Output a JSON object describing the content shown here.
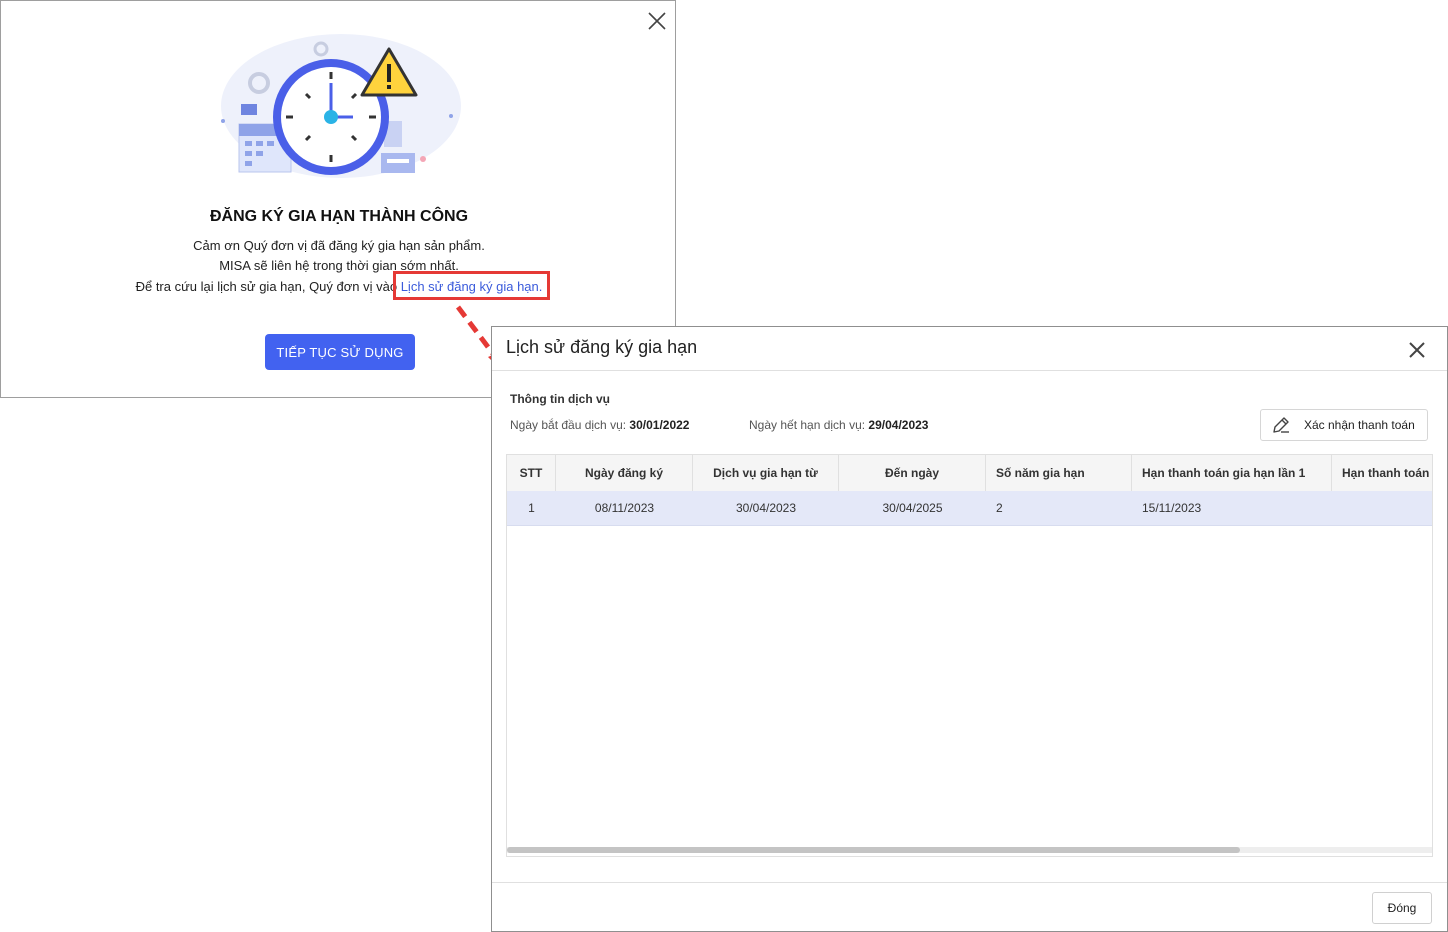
{
  "success_dialog": {
    "title": "ĐĂNG KÝ GIA HẠN THÀNH CÔNG",
    "line1": "Cảm ơn Quý đơn vị đã đăng ký gia hạn sản phẩm.",
    "line2": "MISA sẽ liên hệ trong thời gian sớm nhất.",
    "line3_prefix": "Để tra cứu lại lịch sử gia hạn, Quý đơn vị vào ",
    "history_link": "Lịch sử đăng ký gia hạn.",
    "continue_button": "TIẾP TỤC SỬ DỤNG",
    "close_icon": "close-icon",
    "highlight_color": "#e53935",
    "accent_color": "#4262f0"
  },
  "history_dialog": {
    "title": "Lịch sử đăng ký gia hạn",
    "close_icon": "close-icon",
    "section_title": "Thông tin dịch vụ",
    "start_label": "Ngày bắt đầu dịch vụ: ",
    "start_value": "30/01/2022",
    "end_label": "Ngày hết hạn dịch vụ: ",
    "end_value": "29/04/2023",
    "confirm_button": "Xác nhận thanh toán",
    "confirm_icon": "pencil-icon",
    "columns": [
      "STT",
      "Ngày đăng ký",
      "Dịch vụ gia hạn từ",
      "Đến ngày",
      "Số năm gia hạn",
      "Hạn thanh toán gia hạn lần 1",
      "Hạn thanh toán"
    ],
    "rows": [
      [
        "1",
        "08/11/2023",
        "30/04/2023",
        "30/04/2025",
        "2",
        "15/11/2023",
        ""
      ]
    ],
    "close_button": "Đóng",
    "selected_row_color": "#e4e8f8"
  }
}
